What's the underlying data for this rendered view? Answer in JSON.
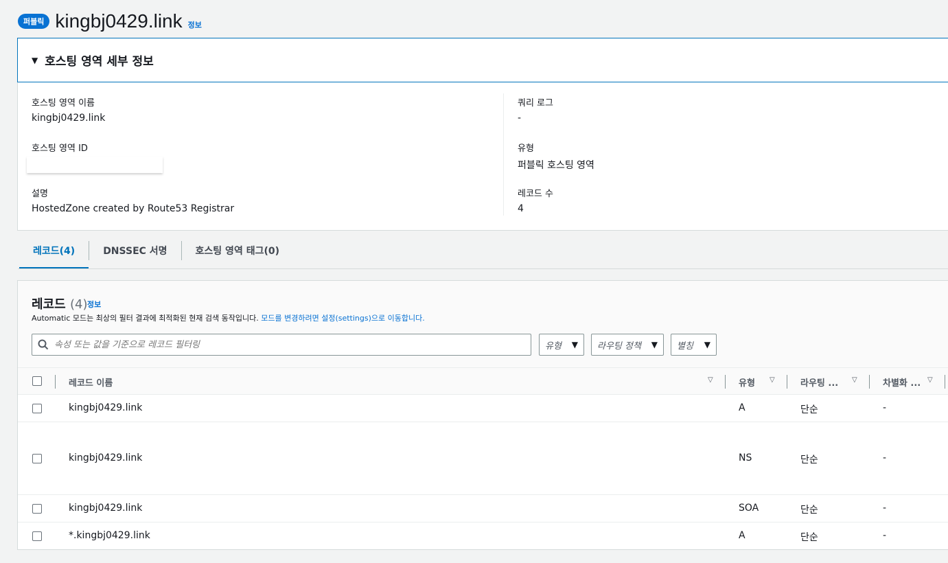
{
  "header": {
    "badge": "퍼블릭",
    "title": "kingbj0429.link",
    "info": "정보"
  },
  "details": {
    "section_title": "호스팅 영역 세부 정보",
    "hosted_zone_name_label": "호스팅 영역 이름",
    "hosted_zone_name_value": "kingbj0429.link",
    "hosted_zone_id_label": "호스팅 영역 ID",
    "description_label": "설명",
    "description_value": "HostedZone created by Route53 Registrar",
    "query_log_label": "쿼리 로그",
    "query_log_value": "-",
    "type_label": "유형",
    "type_value": "퍼블릭 호스팅 영역",
    "record_count_label": "레코드 수",
    "record_count_value": "4"
  },
  "tabs": [
    {
      "label": "레코드(4)"
    },
    {
      "label": "DNSSEC 서명"
    },
    {
      "label": "호스팅 영역 태그(0)"
    }
  ],
  "records": {
    "title": "레코드",
    "count": "(4)",
    "info": "정보",
    "desc_text": "Automatic 모드는 최상의 필터 결과에 최적화된 현재 검색 동작입니다.",
    "desc_link": "모드를 변경하려면 설정(settings)으로 이동합니다.",
    "search_placeholder": "속성 또는 값을 기준으로 레코드 필터링",
    "filters": {
      "type": "유형",
      "routing": "라우팅 정책",
      "alias": "별칭"
    },
    "columns": {
      "name": "레코드 이름",
      "type": "유형",
      "routing": "라우팅 ...",
      "differentiator": "차별화 ..."
    },
    "rows": [
      {
        "name": "kingbj0429.link",
        "type": "A",
        "routing": "단순",
        "diff": "-"
      },
      {
        "name": "kingbj0429.link",
        "type": "NS",
        "routing": "단순",
        "diff": "-"
      },
      {
        "name": "kingbj0429.link",
        "type": "SOA",
        "routing": "단순",
        "diff": "-"
      },
      {
        "name": "*.kingbj0429.link",
        "type": "A",
        "routing": "단순",
        "diff": "-"
      }
    ]
  }
}
